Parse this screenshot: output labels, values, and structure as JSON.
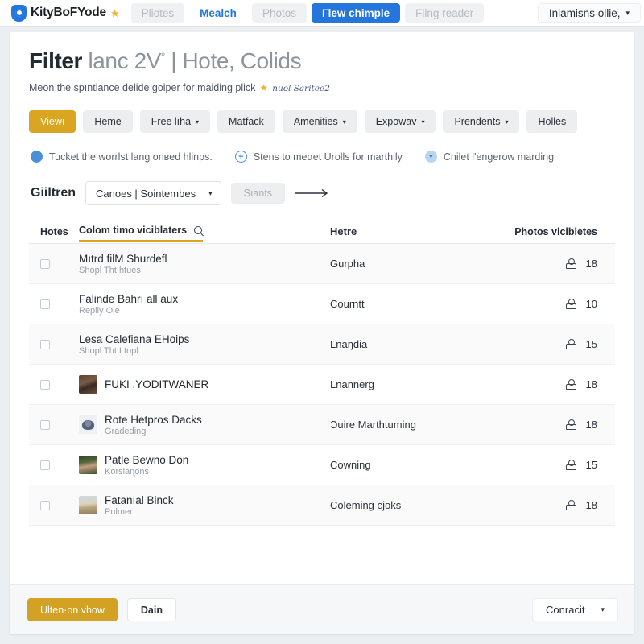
{
  "topbar": {
    "brand": {
      "name": "KityBoFYode",
      "star": "★"
    },
    "items": [
      {
        "label": "Pliotes",
        "style": "muted"
      },
      {
        "label": "Mealch",
        "style": "link"
      },
      {
        "label": "Photos",
        "style": "muted"
      },
      {
        "label": "Гlew chimple",
        "style": "active"
      },
      {
        "label": "Fling reader",
        "style": "muted"
      }
    ],
    "user": {
      "label": "Iniamisns ollie,",
      "caret": "▾"
    }
  },
  "header": {
    "title_bold": "Filter",
    "title_rest": " lanc 2V",
    "title_sup": "°",
    "title_tail": " | Hote, Colids",
    "subtitle": "Meon the spıntiance delide goiper for maiding plick",
    "subtitle_star": "★",
    "subtitle_hand": "nuol Saritee2"
  },
  "pills": [
    {
      "label": "Viewı",
      "caret": "",
      "style": "primary"
    },
    {
      "label": "Heme",
      "caret": "",
      "style": "normal"
    },
    {
      "label": "Free lıha",
      "caret": "▾",
      "style": "normal"
    },
    {
      "label": "Matfack",
      "caret": "",
      "style": "normal"
    },
    {
      "label": "Amenities",
      "caret": "▾",
      "style": "normal"
    },
    {
      "label": "Expowav",
      "caret": "▾",
      "style": "normal"
    },
    {
      "label": "Prendents",
      "caret": "▾",
      "style": "normal"
    },
    {
      "label": "Holles",
      "caret": "",
      "style": "normal"
    }
  ],
  "notes": [
    {
      "icon": "briefcase-icon",
      "glyph": "▬",
      "badge": "b1",
      "text": "Tucket the worrlst lang onвed hlinps."
    },
    {
      "icon": "plus-icon",
      "glyph": "+",
      "badge": "b2",
      "text": "Stens to meαet Urolls for marthily"
    },
    {
      "icon": "chevron-down-icon",
      "glyph": "▾",
      "badge": "b3",
      "text": "Cnilet l'engerow marding"
    }
  ],
  "filter": {
    "label": "Giiltren",
    "select_value": "Canoes | Sointembes",
    "select_caret": "▾",
    "ghost_button": "Sıants",
    "arrow": "⟶"
  },
  "table": {
    "columns": {
      "select": "Hotes",
      "name": "Colom timo viciblaters",
      "search_icon": "search-icon",
      "middle": "Hetre",
      "right": "Photos vicibletes"
    },
    "rows": [
      {
        "name": "Mıtrd filM Shurdefl",
        "sub": "Shopl Tht htues",
        "avatar": "",
        "middle": "Gurpha",
        "count": "18"
      },
      {
        "name": "Falinde Bahrı all aux",
        "sub": "Repily Ole",
        "avatar": "",
        "middle": "Courntt",
        "count": "10"
      },
      {
        "name": "Lesa Calefiana EHoips",
        "sub": "Shopl Tht Ltopl",
        "avatar": "",
        "middle": "Lnaŋdia",
        "count": "15"
      },
      {
        "name": "FUKI .YODITWANER",
        "sub": "",
        "avatar": "a-woman",
        "middle": "Lnannerg",
        "count": "18"
      },
      {
        "name": "Rote Hetpros Dacks",
        "sub": "Gradeding",
        "avatar": "a-crest",
        "middle": "Ɔuire Marthtuming",
        "count": "18"
      },
      {
        "name": "Patle Bewno Don",
        "sub": "Korslaɳons",
        "avatar": "a-man",
        "middle": "Cowning",
        "count": "15"
      },
      {
        "name": "Fatanıal Binck",
        "sub": "Pulmer",
        "avatar": "a-scene",
        "middle": "Coleming єjoks",
        "count": "18"
      }
    ]
  },
  "footer": {
    "primary_label": "Ulten·on vhow",
    "secondary_label": "Dain",
    "select_label": "Conracit",
    "select_caret": "▾"
  },
  "colors": {
    "accent_gold": "#daa520",
    "accent_blue": "#2476dd",
    "page_bg": "#eceff1",
    "card_bg": "#ffffff"
  }
}
